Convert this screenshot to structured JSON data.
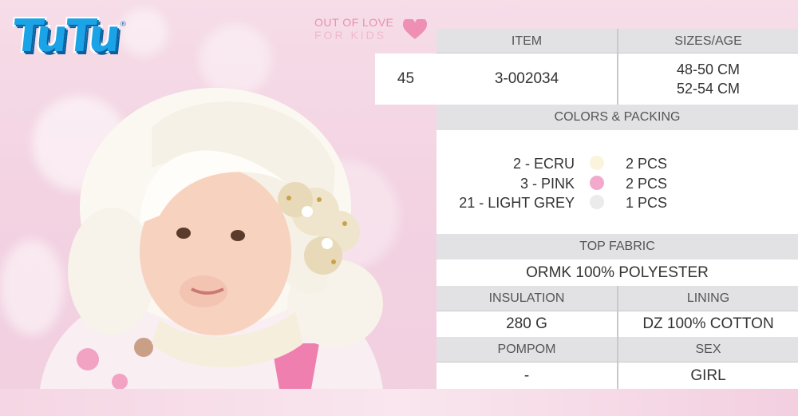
{
  "brand": {
    "logo_text": "TuTu",
    "registered": "®"
  },
  "slogan": {
    "line1": "OUT OF LOVE",
    "line2": "FOR KIDS"
  },
  "product": {
    "number": "45",
    "item_header": "ITEM",
    "item_value": "3-002034",
    "sizes_header": "SIZES/AGE",
    "sizes": [
      "48-50 CM",
      "52-54 CM"
    ],
    "colors_header": "COLORS & PACKING",
    "colors": [
      {
        "name": "2 - ECRU",
        "swatch": "#fbf4dd",
        "qty": "2 PCS"
      },
      {
        "name": "3 - PINK",
        "swatch": "#f3a9cc",
        "qty": "2 PCS"
      },
      {
        "name": "21 - LIGHT GREY",
        "swatch": "#ebebeb",
        "qty": "1 PCS"
      }
    ],
    "top_fabric_header": "TOP FABRIC",
    "top_fabric_value": "ORMK 100% POLYESTER",
    "insulation_header": "INSULATION",
    "insulation_value": "280 G",
    "lining_header": "LINING",
    "lining_value": "DZ 100% COTTON",
    "pompom_header": "POMPOM",
    "pompom_value": "-",
    "sex_header": "SEX",
    "sex_value": "GIRL"
  },
  "colors": {
    "brand_blue": "#1aa3e6",
    "heart_pink": "#ef8fb3",
    "header_grey": "#e2e2e4"
  }
}
